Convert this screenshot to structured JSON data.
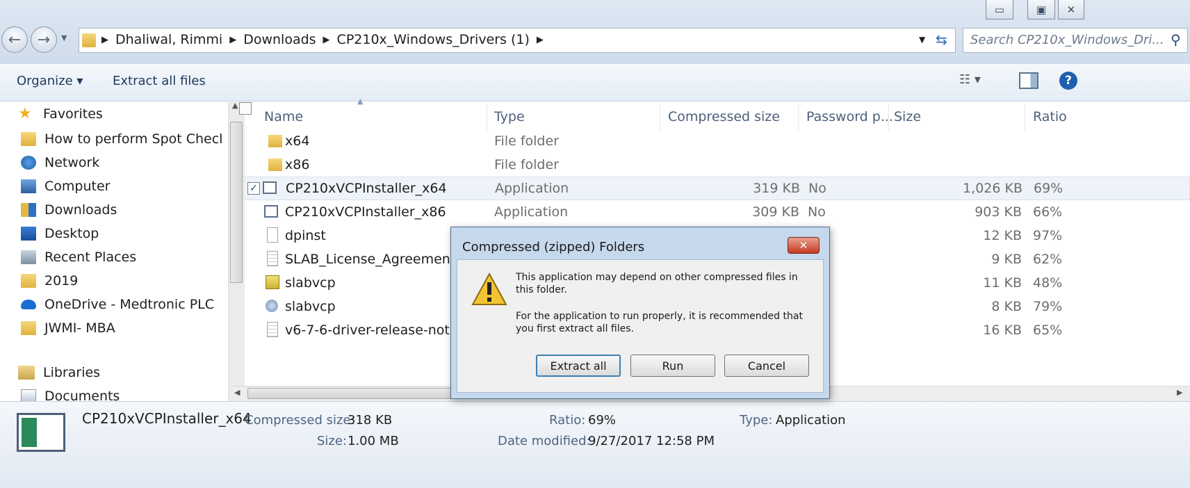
{
  "window": {
    "controls": [
      "minimize",
      "maximize",
      "close"
    ]
  },
  "address": {
    "breadcrumbs": [
      "Dhaliwal, Rimmi",
      "Downloads",
      "CP210x_Windows_Drivers (1)"
    ],
    "search_placeholder": "Search CP210x_Windows_Dri..."
  },
  "toolbar": {
    "organize_label": "Organize ▾",
    "extract_label": "Extract all files"
  },
  "sidebar": {
    "favorites_label": "Favorites",
    "items": [
      {
        "label": "How to perform Spot Checl",
        "icon": "folder-icon"
      },
      {
        "label": "Network",
        "icon": "network-icon"
      },
      {
        "label": "Computer",
        "icon": "computer-icon"
      },
      {
        "label": "Downloads",
        "icon": "downloads-icon"
      },
      {
        "label": "Desktop",
        "icon": "desktop-icon"
      },
      {
        "label": "Recent Places",
        "icon": "recent-places-icon"
      },
      {
        "label": "2019",
        "icon": "folder-icon"
      },
      {
        "label": "OneDrive - Medtronic PLC",
        "icon": "onedrive-icon"
      },
      {
        "label": "JWMI- MBA",
        "icon": "folder-icon"
      }
    ],
    "libraries_label": "Libraries",
    "documents_label": "Documents"
  },
  "columns": {
    "name": "Name",
    "type": "Type",
    "compressed": "Compressed size",
    "password": "Password p...",
    "size": "Size",
    "ratio": "Ratio"
  },
  "files": [
    {
      "name": "x64",
      "type": "File folder",
      "compressed": "",
      "password": "",
      "size": "",
      "ratio": "",
      "icon": "folder-icon"
    },
    {
      "name": "x86",
      "type": "File folder",
      "compressed": "",
      "password": "",
      "size": "",
      "ratio": "",
      "icon": "folder-icon"
    },
    {
      "name": "CP210xVCPInstaller_x64",
      "type": "Application",
      "compressed": "319 KB",
      "password": "No",
      "size": "1,026 KB",
      "ratio": "69%",
      "icon": "application-icon"
    },
    {
      "name": "CP210xVCPInstaller_x86",
      "type": "Application",
      "compressed": "309 KB",
      "password": "No",
      "size": "903 KB",
      "ratio": "66%",
      "icon": "application-icon"
    },
    {
      "name": "dpinst",
      "type": "",
      "compressed": "",
      "password": "",
      "size": "12 KB",
      "ratio": "97%",
      "icon": "document-icon"
    },
    {
      "name": "SLAB_License_Agreement_VC",
      "type": "",
      "compressed": "",
      "password": "",
      "size": "9 KB",
      "ratio": "62%",
      "icon": "text-file-icon"
    },
    {
      "name": "slabvcp",
      "type": "",
      "compressed": "",
      "password": "",
      "size": "11 KB",
      "ratio": "48%",
      "icon": "setup-info-icon"
    },
    {
      "name": "slabvcp",
      "type": "",
      "compressed": "",
      "password": "",
      "size": "8 KB",
      "ratio": "79%",
      "icon": "security-catalog-icon"
    },
    {
      "name": "v6-7-6-driver-release-notes",
      "type": "",
      "compressed": "",
      "password": "",
      "size": "16 KB",
      "ratio": "65%",
      "icon": "text-file-icon"
    }
  ],
  "details": {
    "name": "CP210xVCPInstaller_x64",
    "compressed_label": "Compressed size:",
    "compressed_value": "318 KB",
    "size_label": "Size:",
    "size_value": "1.00 MB",
    "ratio_label": "Ratio:",
    "ratio_value": "69%",
    "date_label": "Date modified:",
    "date_value": "9/27/2017 12:58 PM",
    "type_label": "Type:",
    "type_value": "Application"
  },
  "dialog": {
    "title": "Compressed (zipped) Folders",
    "message1": "This application may depend on other compressed files in this folder.",
    "message2": "For the application to run properly, it is recommended that you first extract all files.",
    "buttons": {
      "extract": "Extract all",
      "run": "Run",
      "cancel": "Cancel"
    }
  }
}
